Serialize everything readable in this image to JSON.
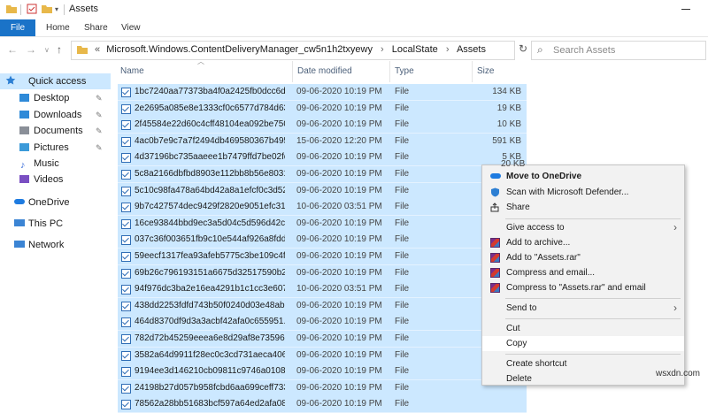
{
  "window": {
    "title": "Assets"
  },
  "ribbon": {
    "tabs": [
      "File",
      "Home",
      "Share",
      "View"
    ]
  },
  "address": {
    "overflow": "«",
    "crumbs": [
      "Microsoft.Windows.ContentDeliveryManager_cw5n1h2txyewy",
      "LocalState",
      "Assets"
    ]
  },
  "search": {
    "placeholder": "Search Assets"
  },
  "nav": {
    "items": [
      {
        "label": "Quick access",
        "icon": "star-icon",
        "color": "#2d7fd3"
      },
      {
        "label": "Desktop",
        "icon": "desktop-folder-icon",
        "color": "#2f8ad8"
      },
      {
        "label": "Downloads",
        "icon": "downloads-folder-icon",
        "color": "#2f8ad8"
      },
      {
        "label": "Documents",
        "icon": "documents-folder-icon",
        "color": "#8a8f98"
      },
      {
        "label": "Pictures",
        "icon": "pictures-folder-icon",
        "color": "#3b9ad9"
      },
      {
        "label": "Music",
        "icon": "music-icon",
        "color": "#3b6fd9"
      },
      {
        "label": "Videos",
        "icon": "videos-folder-icon",
        "color": "#7a4fc2"
      },
      {
        "label": "OneDrive",
        "icon": "onedrive-icon",
        "color": "#1e7be0"
      },
      {
        "label": "This PC",
        "icon": "computer-icon",
        "color": "#3b84d4"
      },
      {
        "label": "Network",
        "icon": "network-icon",
        "color": "#3b84d4"
      }
    ]
  },
  "columns": {
    "name": "Name",
    "date": "Date modified",
    "type": "Type",
    "size": "Size"
  },
  "files": [
    {
      "name": "1bc7240aa77373ba4f0a2425fb0dcc6d5c...",
      "date": "09-06-2020 10:19 PM",
      "type": "File",
      "size": "134 KB"
    },
    {
      "name": "2e2695a085e8e1333cf0c6577d784d631b...",
      "date": "09-06-2020 10:19 PM",
      "type": "File",
      "size": "19 KB"
    },
    {
      "name": "2f45584e22d60c4cff48104ea092be750d5...",
      "date": "09-06-2020 10:19 PM",
      "type": "File",
      "size": "10 KB"
    },
    {
      "name": "4ac0b7e9c7a7f2494db469580367b49511...",
      "date": "15-06-2020 12:20 PM",
      "type": "File",
      "size": "591 KB"
    },
    {
      "name": "4d37196bc735aaeee1b7479ffd7be02fd8...",
      "date": "09-06-2020 10:19 PM",
      "type": "File",
      "size": "5 KB"
    },
    {
      "name": "5c8a2166dbfbd8903e112bb8b56e80318...",
      "date": "09-06-2020 10:19 PM",
      "type": "File",
      "size": ""
    },
    {
      "name": "5c10c98fa478a64bd42a8a1efcf0c3d5296...",
      "date": "09-06-2020 10:19 PM",
      "type": "File",
      "size": ""
    },
    {
      "name": "9b7c427574dec9429f2820e9051efc31ad...",
      "date": "10-06-2020 03:51 PM",
      "type": "File",
      "size": ""
    },
    {
      "name": "16ce93844bbd9ec3a5d04c5d596d42c36...",
      "date": "09-06-2020 10:19 PM",
      "type": "File",
      "size": ""
    },
    {
      "name": "037c36f003651fb9c10e544af926a8fdd51...",
      "date": "09-06-2020 10:19 PM",
      "type": "File",
      "size": ""
    },
    {
      "name": "59eecf1317fea93afeb5775c3be109c4f87...",
      "date": "09-06-2020 10:19 PM",
      "type": "File",
      "size": ""
    },
    {
      "name": "69b26c796193151a6675d32517590b2a4...",
      "date": "09-06-2020 10:19 PM",
      "type": "File",
      "size": ""
    },
    {
      "name": "94f976dc3ba2e16ea4291b1c1cc3e6072...",
      "date": "10-06-2020 03:51 PM",
      "type": "File",
      "size": ""
    },
    {
      "name": "438dd2253fdfd743b50f0240d03e48ab81...",
      "date": "09-06-2020 10:19 PM",
      "type": "File",
      "size": ""
    },
    {
      "name": "464d8370df9d3a3acbf42afa0c655951...",
      "date": "09-06-2020 10:19 PM",
      "type": "File",
      "size": ""
    },
    {
      "name": "782d72b45259eeea6e8d29af8e7359638d...",
      "date": "09-06-2020 10:19 PM",
      "type": "File",
      "size": ""
    },
    {
      "name": "3582a64d9911f28ec0c3cd731aeca4069...",
      "date": "09-06-2020 10:19 PM",
      "type": "File",
      "size": ""
    },
    {
      "name": "9194ee3d146210cb09811c9746a0108f88...",
      "date": "09-06-2020 10:19 PM",
      "type": "File",
      "size": ""
    },
    {
      "name": "24198b27d057b958fcbd6aa699ceff733d...",
      "date": "09-06-2020 10:19 PM",
      "type": "File",
      "size": ""
    },
    {
      "name": "78562a28bb51683bcf597a64ed2afa085d...",
      "date": "09-06-2020 10:19 PM",
      "type": "File",
      "size": ""
    }
  ],
  "size_partial": "20 KB",
  "context_menu": {
    "items": [
      {
        "label": "Move to OneDrive",
        "icon": "onedrive-icon",
        "bold": true
      },
      {
        "label": "Scan with Microsoft Defender...",
        "icon": "defender-icon"
      },
      {
        "label": "Share",
        "icon": "share-icon"
      },
      {
        "label": "Give access to",
        "icon": "",
        "submenu": true
      },
      {
        "label": "Add to archive...",
        "icon": "winrar-icon"
      },
      {
        "label": "Add to \"Assets.rar\"",
        "icon": "winrar-icon"
      },
      {
        "label": "Compress and email...",
        "icon": "winrar-icon"
      },
      {
        "label": "Compress to \"Assets.rar\" and email",
        "icon": "winrar-icon"
      },
      {
        "label": "Send to",
        "icon": "",
        "submenu": true
      },
      {
        "label": "Cut",
        "icon": ""
      },
      {
        "label": "Copy",
        "icon": "",
        "highlighted": true
      },
      {
        "label": "Create shortcut",
        "icon": ""
      },
      {
        "label": "Delete",
        "icon": ""
      }
    ]
  },
  "watermark": "wsxdn.com",
  "colors": {
    "selection": "#cce8ff",
    "file_tab": "#1a73c8",
    "folder_yellow": "#e8b84a"
  }
}
